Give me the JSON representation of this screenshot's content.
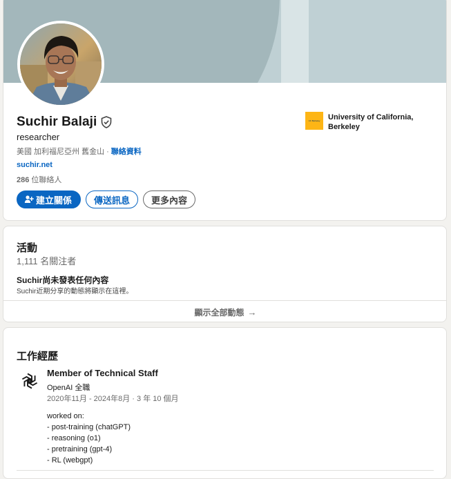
{
  "profile": {
    "name": "Suchir Balaji",
    "headline": "researcher",
    "location": "美國 加利福尼亞州 舊金山",
    "location_separator": "·",
    "contact_info_label": "聯絡資料",
    "website": "suchir.net",
    "connections_count": "286",
    "connections_label": "位聯絡人",
    "education": {
      "school_name": "University of California, Berkeley",
      "logo_text": "UC Berkeley"
    },
    "buttons": {
      "connect": "建立關係",
      "message": "傳送訊息",
      "more": "更多內容"
    },
    "verified_icon": "shield-check-icon"
  },
  "activity": {
    "title": "活動",
    "followers": "1,111 名關注者",
    "no_posts_title": "Suchir尚未發表任何內容",
    "no_posts_subtitle": "Suchir近期分享的動態將顯示在這裡。",
    "show_all_label": "顯示全部動態",
    "show_all_arrow": "→"
  },
  "experience": {
    "title": "工作經歷",
    "items": [
      {
        "role": "Member of Technical Staff",
        "company": "OpenAI 全職",
        "dates": "2020年11月 - 2024年8月 · 3 年 10 個月",
        "description": [
          "worked on:",
          "- post-training (chatGPT)",
          "- reasoning (o1)",
          "- pretraining (gpt-4)",
          "- RL (webgpt)"
        ],
        "logo_icon": "openai-logo-icon"
      }
    ]
  },
  "colors": {
    "primary_blue": "#0a66c2",
    "page_background": "#f3f2ef",
    "banner_base": "#bfd0d4",
    "banner_dark": "#a3b7bb",
    "berkeley_gold": "#fdb515"
  }
}
